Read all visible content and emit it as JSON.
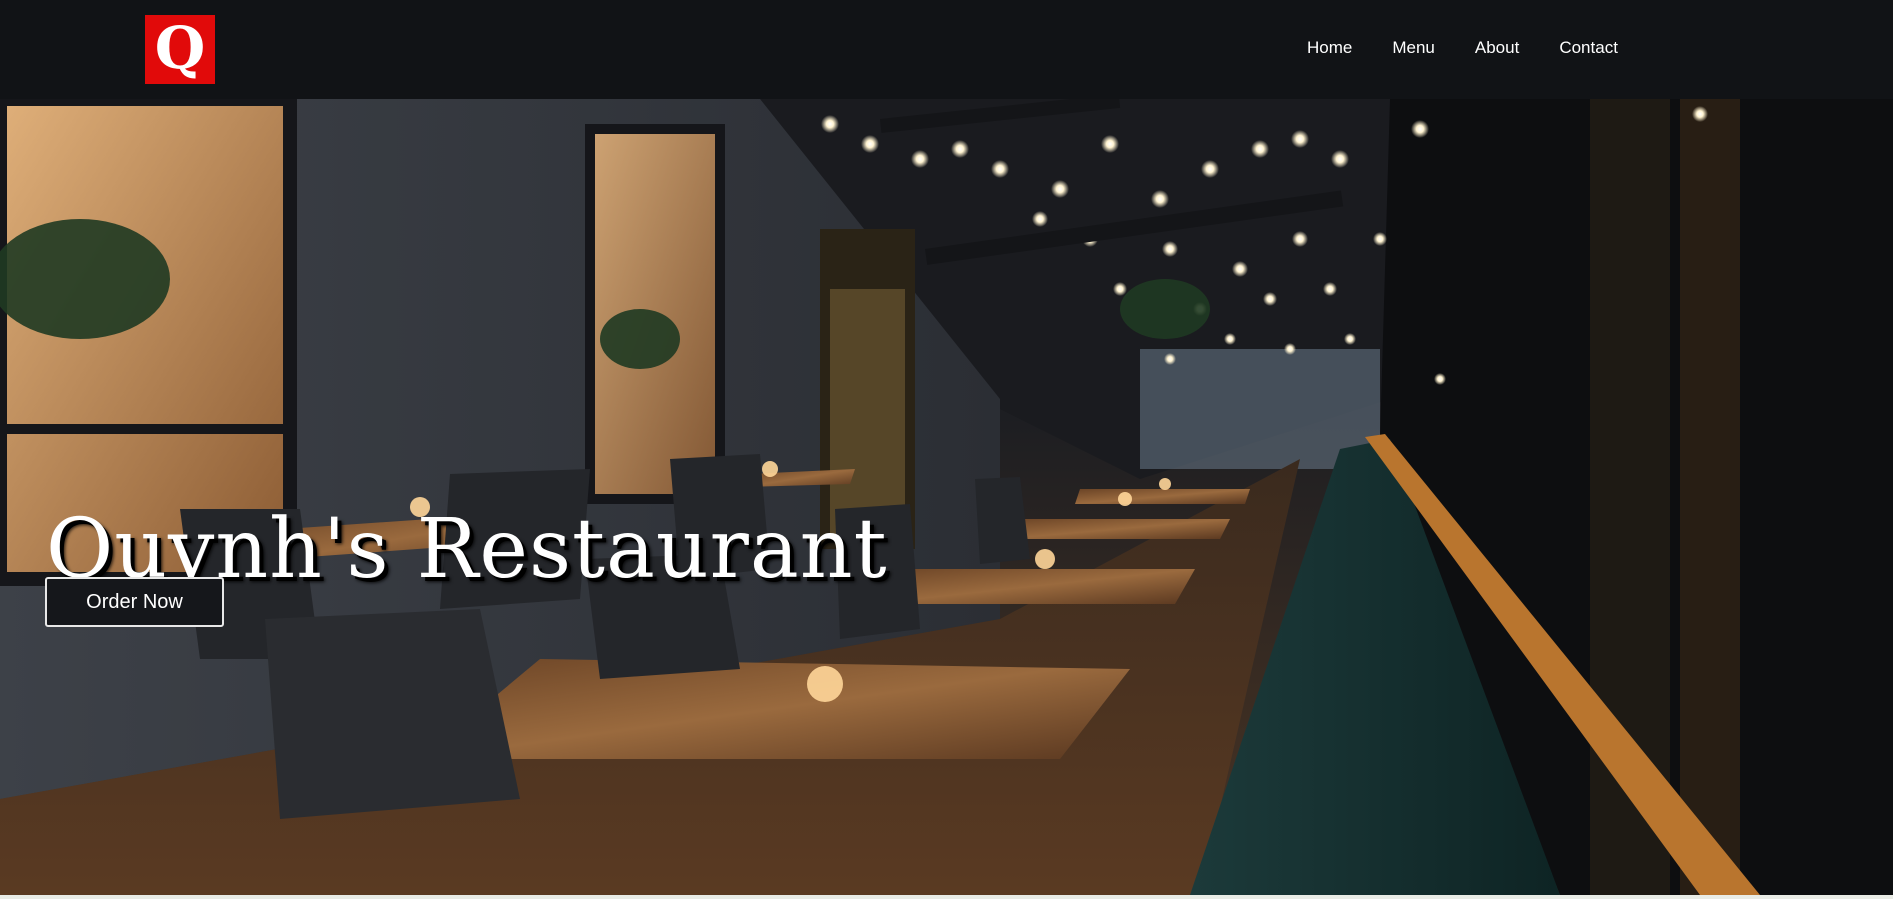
{
  "logo": {
    "letter": "Q",
    "color": "#e10a0a"
  },
  "nav": {
    "items": [
      {
        "label": "Home"
      },
      {
        "label": "Menu"
      },
      {
        "label": "About"
      },
      {
        "label": "Contact"
      }
    ]
  },
  "hero": {
    "title": "Quynh's Restaurant",
    "cta_label": "Order Now",
    "image_subject": "restaurant-patio-photo"
  },
  "colors": {
    "navbar_bg": "#111316",
    "accent": "#e10a0a",
    "button_bg": "#15171b"
  }
}
